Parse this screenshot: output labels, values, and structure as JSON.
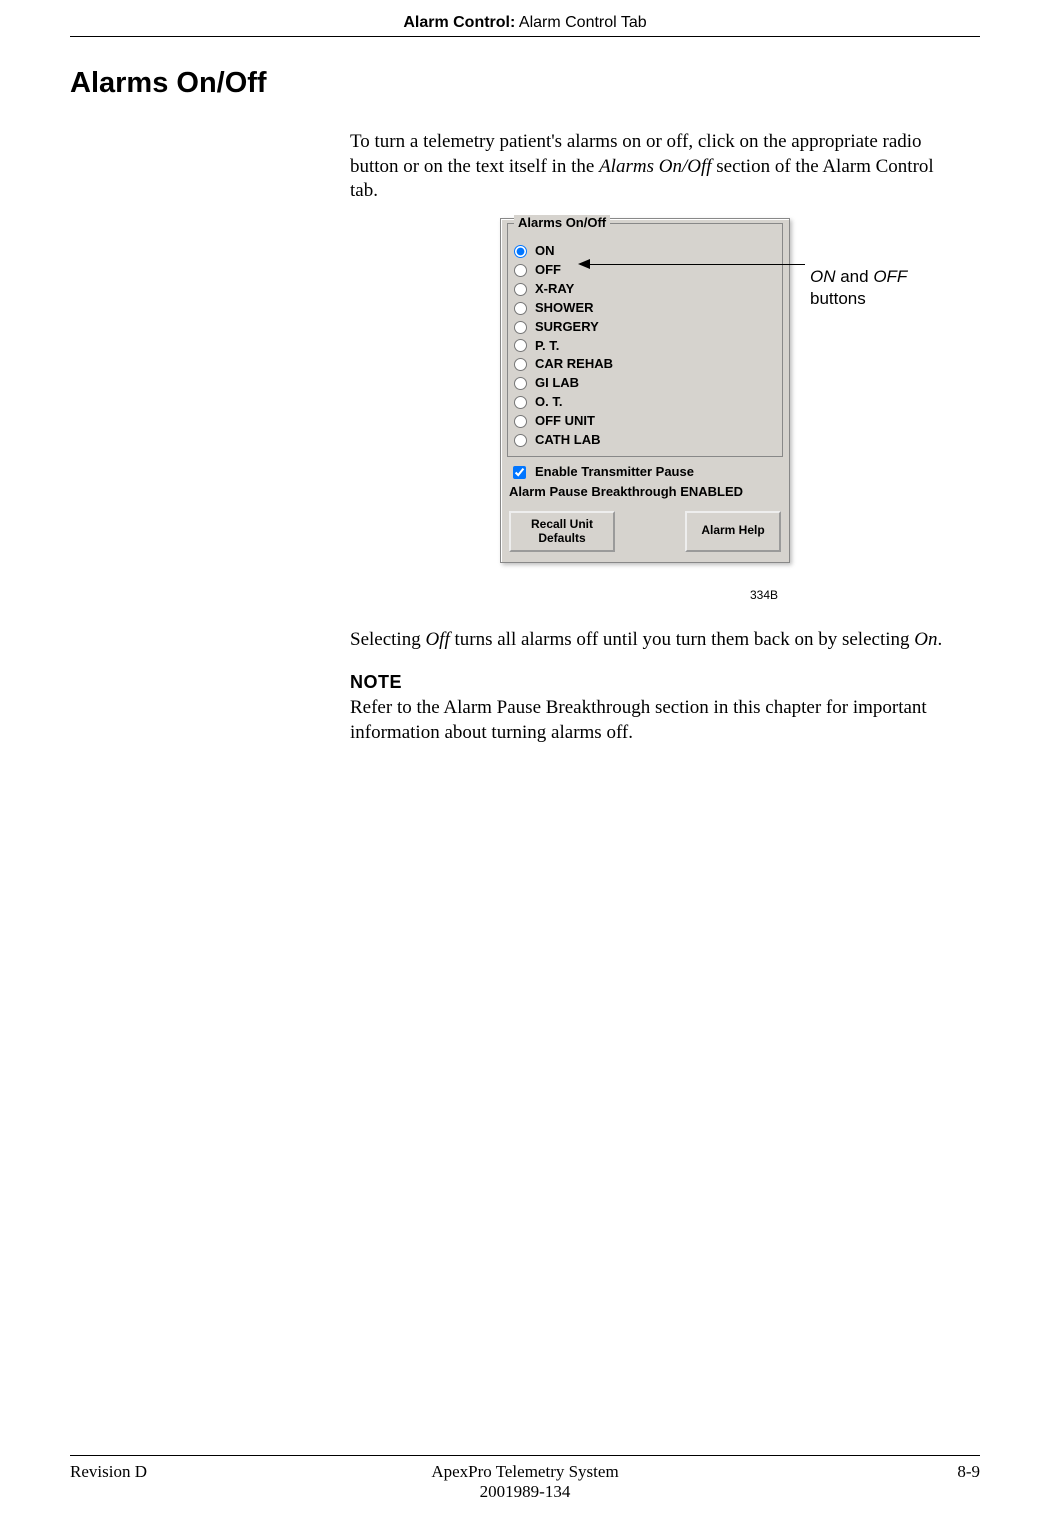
{
  "header": {
    "bold": "Alarm Control:",
    "rest": " Alarm Control Tab"
  },
  "title": "Alarms On/Off",
  "para1": {
    "pre": "To turn a telemetry patient's alarms on or off, click on the appropriate radio button or on the text itself in the ",
    "it": "Alarms On/Off",
    "post": " section of the Alarm Control tab."
  },
  "dialog": {
    "group_title": "Alarms On/Off",
    "options": [
      "ON",
      "OFF",
      "X-RAY",
      "SHOWER",
      "SURGERY",
      "P. T.",
      "CAR REHAB",
      "GI LAB",
      "O. T.",
      "OFF UNIT",
      "CATH LAB"
    ],
    "selected_index": 0,
    "checkbox_label": "Enable Transmitter Pause",
    "checkbox_checked": true,
    "status": "Alarm Pause Breakthrough ENABLED",
    "btn_recall": "Recall Unit Defaults",
    "btn_help": "Alarm Help"
  },
  "fig_id": "334B",
  "callout": {
    "on": "ON",
    "and": " and ",
    "off": "OFF",
    "tail": "buttons"
  },
  "para2": {
    "pre": "Selecting ",
    "off": "Off",
    "mid": " turns all alarms off until you turn them back on by selecting ",
    "on": "On",
    "post": "."
  },
  "note_hd": "NOTE",
  "note_body": "Refer to the Alarm Pause Breakthrough section in this chapter for important information about turning alarms off.",
  "footer": {
    "left": "Revision D",
    "center1": "ApexPro Telemetry System",
    "center2": "2001989-134",
    "right": "8-9"
  }
}
